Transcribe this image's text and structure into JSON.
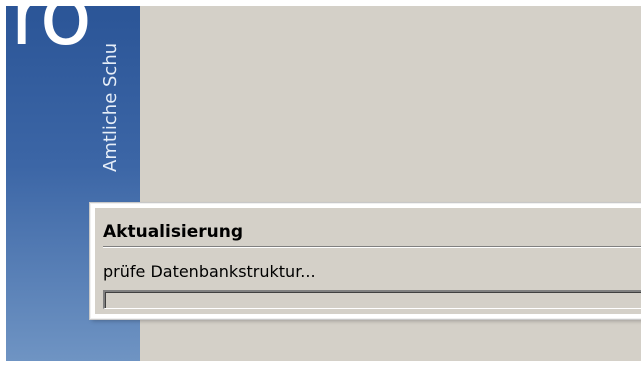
{
  "splash": {
    "logo_text": "ro",
    "caption": "Amtliche Schu"
  },
  "dialog": {
    "title": "Aktualisierung",
    "status": "prüfe Datenbankstruktur...",
    "progress": 0
  },
  "colors": {
    "sidebar_top": "#2b5597",
    "sidebar_bottom": "#6f94c3",
    "window_bg": "#d4d0c8",
    "progress_fill": "#0a246a"
  }
}
